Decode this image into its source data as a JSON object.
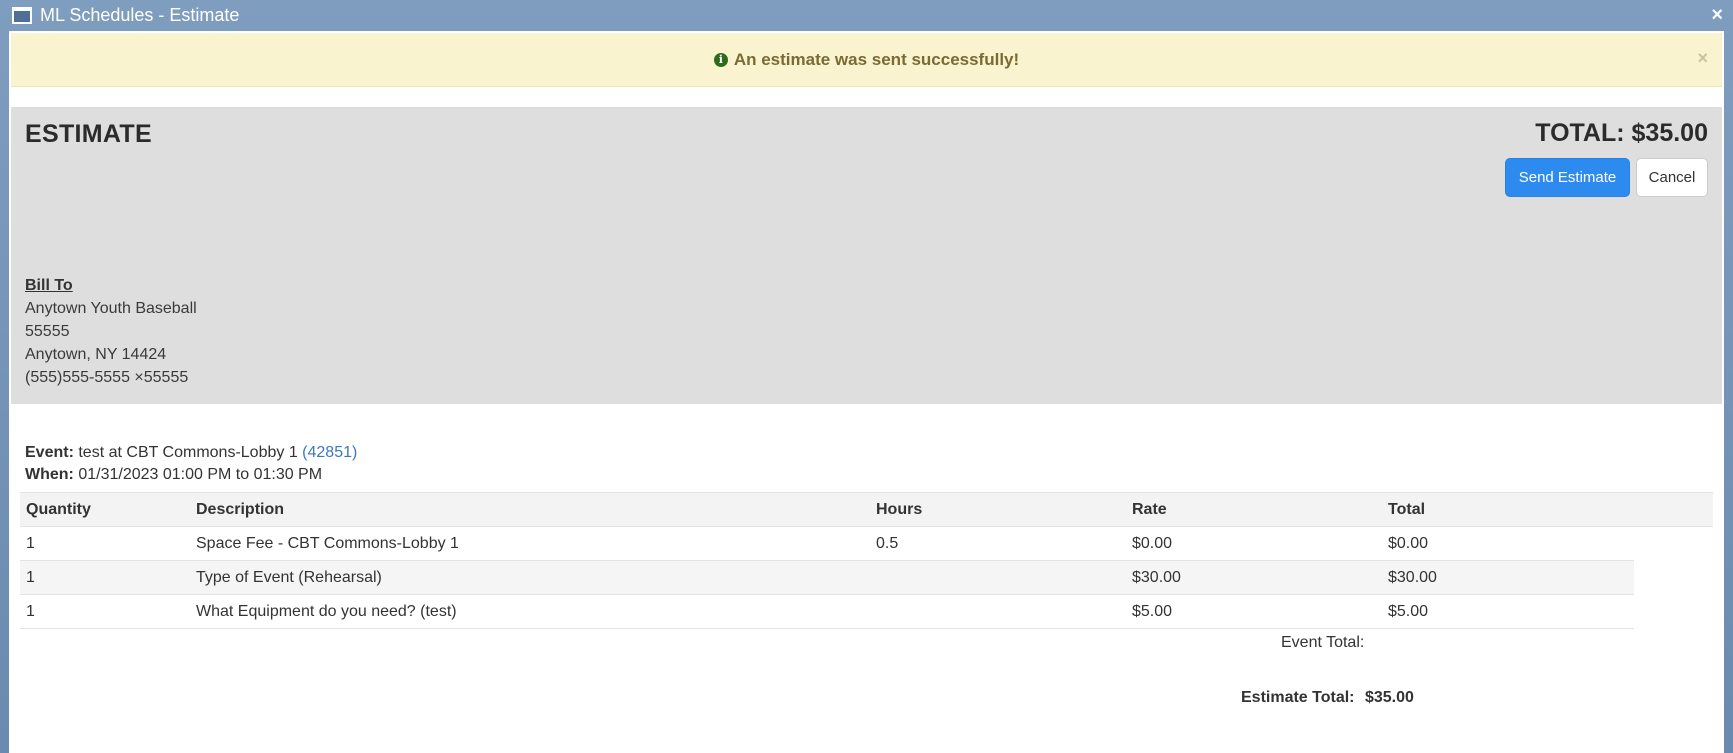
{
  "window": {
    "title": "ML Schedules - Estimate",
    "close_label": "×"
  },
  "alert": {
    "icon": "info-circle-icon",
    "message": "An estimate was sent successfully!",
    "close_label": "×"
  },
  "header": {
    "title": "ESTIMATE",
    "total_label": "TOTAL: $35.00",
    "send_button": "Send Estimate",
    "cancel_button": "Cancel"
  },
  "bill_to": {
    "label": "Bill To",
    "lines": [
      "Anytown Youth Baseball",
      "55555",
      "Anytown, NY 14424",
      "(555)555-5555 ×55555"
    ]
  },
  "event": {
    "event_label": "Event:",
    "event_text": "test at CBT Commons-Lobby 1",
    "event_id": "(42851)",
    "when_label": "When:",
    "when_text": "01/31/2023 01:00 PM to 01:30 PM"
  },
  "table": {
    "headers": [
      "Quantity",
      "Description",
      "Hours",
      "Rate",
      "Total"
    ],
    "rows": [
      [
        "1",
        "Space Fee - CBT Commons-Lobby 1",
        "0.5",
        "$0.00",
        "$0.00"
      ],
      [
        "1",
        "Type of Event (Rehearsal)",
        "",
        "$30.00",
        "$30.00"
      ],
      [
        "1",
        "What Equipment do you need? (test)",
        "",
        "$5.00",
        "$5.00"
      ]
    ]
  },
  "totals": {
    "event_total_label": "Event Total:",
    "estimate_total_label": "Estimate Total:",
    "estimate_total_value": "$35.00"
  },
  "colors": {
    "primary_button": "#2d8bf0",
    "alert_background": "#faf3cf",
    "header_background": "#dedede",
    "link": "#3b78c4"
  }
}
